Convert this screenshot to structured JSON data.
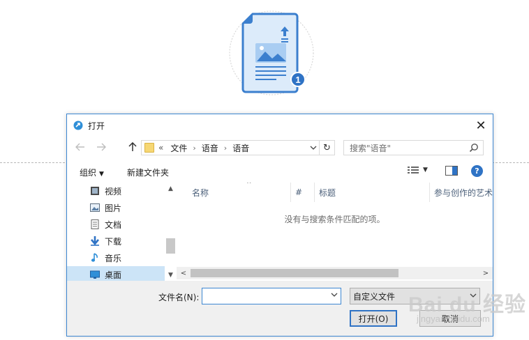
{
  "window": {
    "title": "打开",
    "close_glyph": "✕"
  },
  "navigation": {
    "back_icon": "arrow-left-icon",
    "forward_icon": "arrow-right-icon",
    "up_icon": "arrow-up-icon",
    "breadcrumb_prefix": "«",
    "breadcrumbs": [
      "文件",
      "语音",
      "语音"
    ],
    "crumb_separator": "›",
    "dropdown_glyph": "⌄",
    "refresh_glyph": "↻"
  },
  "search": {
    "placeholder": "搜索\"语音\""
  },
  "toolbar": {
    "organize_label": "组织",
    "organize_caret": "▼",
    "new_folder_label": "新建文件夹",
    "view_caret": "▼",
    "help_glyph": "?"
  },
  "nav_pane": {
    "items": [
      {
        "label": "视频",
        "icon": "video-icon",
        "selected": false
      },
      {
        "label": "图片",
        "icon": "pictures-icon",
        "selected": false
      },
      {
        "label": "文档",
        "icon": "documents-icon",
        "selected": false
      },
      {
        "label": "下载",
        "icon": "downloads-icon",
        "selected": false
      },
      {
        "label": "音乐",
        "icon": "music-icon",
        "selected": false
      },
      {
        "label": "桌面",
        "icon": "desktop-icon",
        "selected": true
      }
    ],
    "scroll_up_glyph": "▲",
    "scroll_down_glyph": "▼"
  },
  "file_list": {
    "columns": [
      "名称",
      "#",
      "标题",
      "参与创作的艺术"
    ],
    "sort_glyph": "^",
    "empty_message": "没有与搜索条件匹配的项。",
    "scroll_left_glyph": "<",
    "scroll_right_glyph": ">"
  },
  "bottom": {
    "filename_label": "文件名(N):",
    "filename_value": "",
    "filetype_value": "自定义文件",
    "open_label": "打开(O)",
    "cancel_label": "取消"
  },
  "watermark": {
    "text": "Bai du 经验",
    "url": "jingyan.baidu.com"
  },
  "colors": {
    "accent": "#2f73c5",
    "border_accent": "#3c86d1",
    "selection": "#cce4f7",
    "hero_icon": "#3b7fce"
  }
}
